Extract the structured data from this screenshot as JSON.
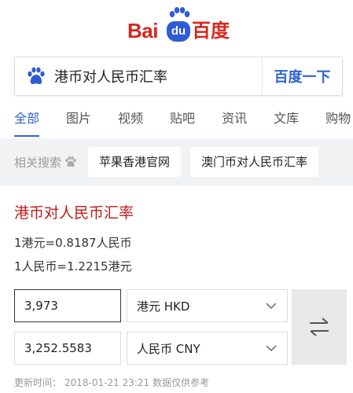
{
  "logo": {
    "part1": "Bai",
    "part2": "du",
    "part3": "百度"
  },
  "search": {
    "query": "港币对人民币汇率",
    "button_label": "百度一下"
  },
  "tabs": [
    {
      "label": "全部",
      "active": true
    },
    {
      "label": "图片"
    },
    {
      "label": "视频"
    },
    {
      "label": "贴吧"
    },
    {
      "label": "资讯"
    },
    {
      "label": "文库"
    },
    {
      "label": "购物"
    }
  ],
  "related": {
    "label": "相关搜索",
    "items": [
      "苹果香港官网",
      "澳门币对人民币汇率"
    ]
  },
  "result": {
    "title": "港币对人民币汇率",
    "rate_hkd_cny": "1港元=0.8187人民币",
    "rate_cny_hkd": "1人民币=1.2215港元",
    "amount_from": "3,973",
    "amount_to": "3,252.5583",
    "currency_from": "港元 HKD",
    "currency_to": "人民币 CNY",
    "update_label": "更新时间：",
    "update_time": "2018-01-21 23:21",
    "disclaimer": "数据仅供参考"
  },
  "colors": {
    "brand_blue": "#2e63d8",
    "brand_red": "#d8261d",
    "title_red": "#c11b17"
  }
}
